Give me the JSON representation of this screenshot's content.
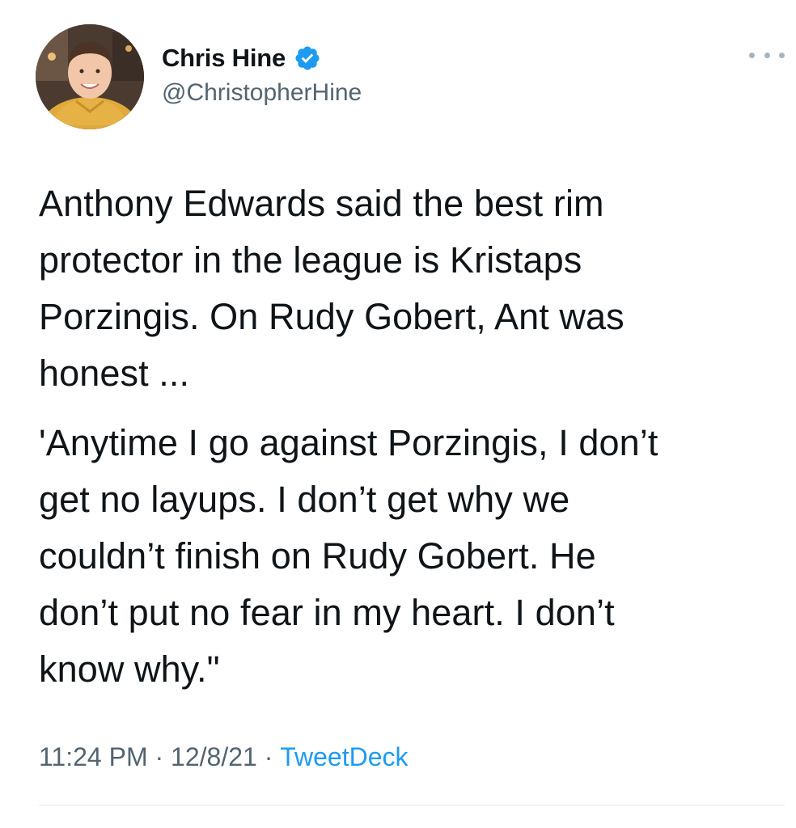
{
  "author": {
    "display_name": "Chris Hine",
    "handle": "@ChristopherHine",
    "verified_icon": "verified-badge-icon",
    "badge_color": "#1d9bf0"
  },
  "menu_icon": "more-options-icon",
  "tweet": {
    "paragraph_1": "Anthony Edwards said the best rim\nprotector in the league is Kristaps\nPorzingis. On Rudy Gobert, Ant was\nhonest ...",
    "paragraph_2": "'Anytime I go against Porzingis, I don’t\nget no layups. I don’t get why we\ncouldn’t finish on Rudy Gobert. He\ndon’t put no fear in my heart. I don’t\nknow why.\""
  },
  "meta": {
    "time": "11:24 PM",
    "separator": " · ",
    "date": "12/8/21",
    "source": "TweetDeck"
  },
  "colors": {
    "text": "#0f1419",
    "secondary": "#536471",
    "link": "#1d9bf0"
  }
}
